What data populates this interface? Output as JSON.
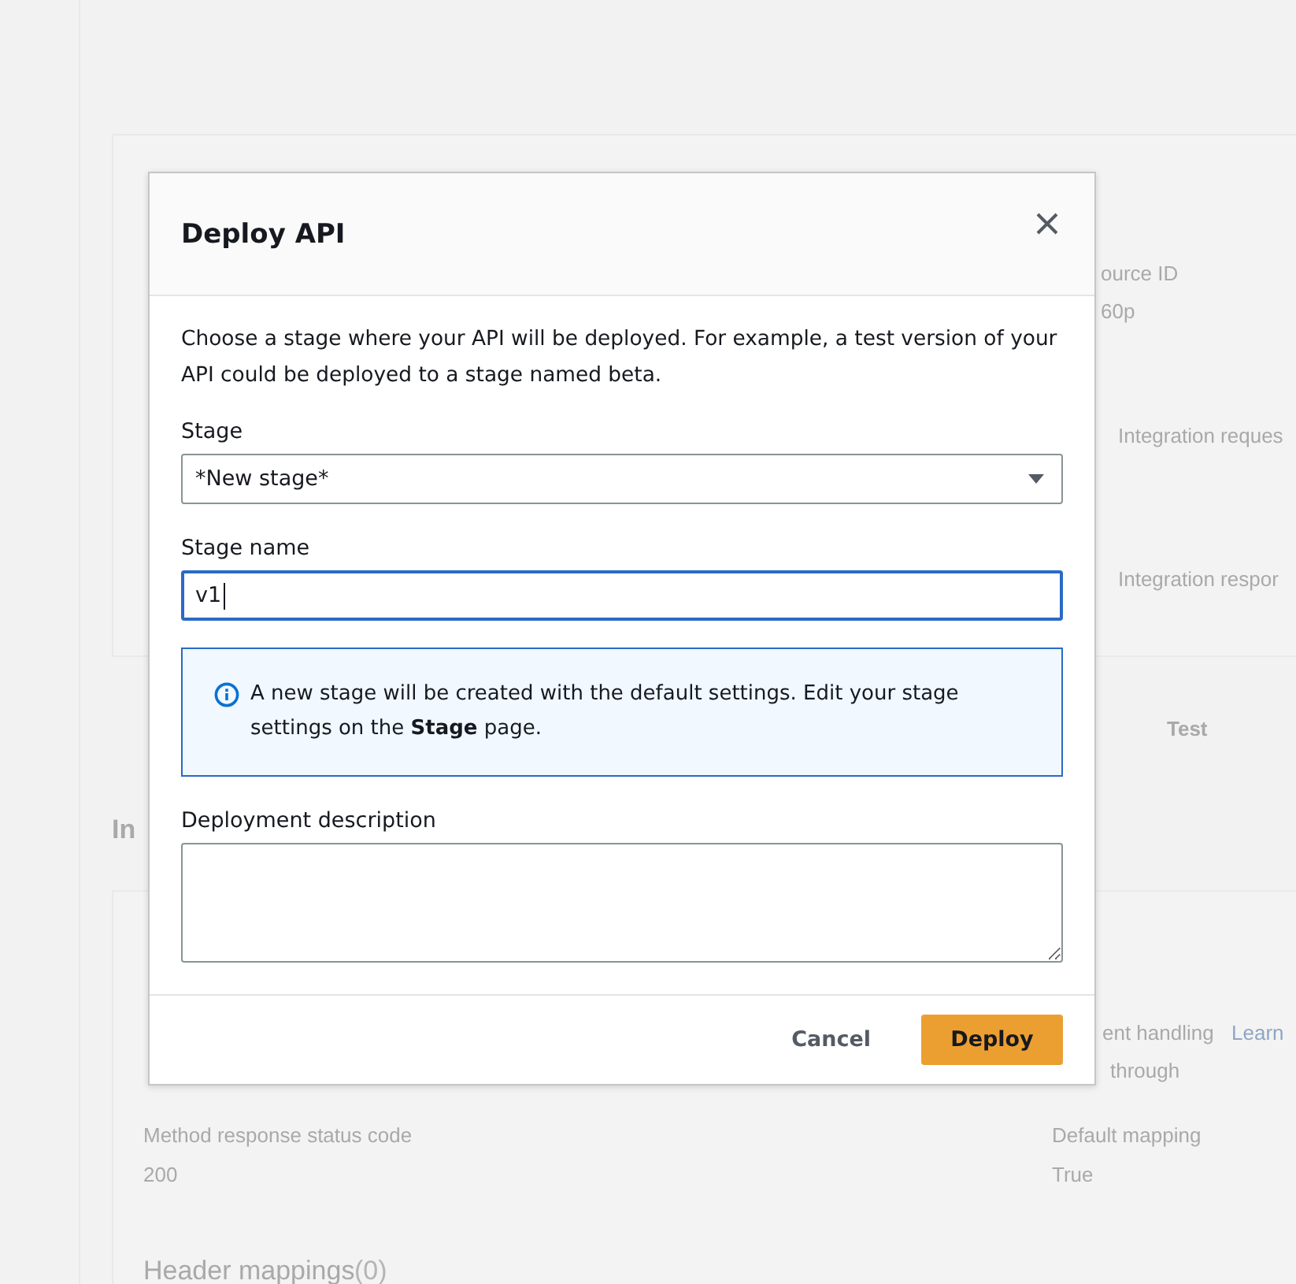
{
  "background": {
    "texts": [
      {
        "text": "ource ID"
      },
      {
        "text": "60p"
      },
      {
        "text": "Integration reques"
      },
      {
        "text": "Integration respor"
      },
      {
        "text": "Test"
      },
      {
        "text": "In"
      },
      {
        "text": "ent handling"
      },
      {
        "text": "Learn",
        "kind": "link"
      },
      {
        "text": "through"
      },
      {
        "text": "Method response status code"
      },
      {
        "text": "200"
      },
      {
        "text": "Default mapping"
      },
      {
        "text": "True"
      },
      {
        "text": "Header mappings"
      },
      {
        "text": "(0)"
      }
    ]
  },
  "dialog": {
    "title": "Deploy API",
    "description": "Choose a stage where your API will be deployed. For example, a test version of your API could be deployed to a stage named beta.",
    "fields": [
      {
        "kind": "select",
        "label": "Stage",
        "value": "*New stage*",
        "focused": false
      },
      {
        "kind": "text",
        "label": "Stage name",
        "value": "v1",
        "focused": true
      },
      {
        "kind": "info",
        "text": "A new stage will be created with the default settings. Edit your stage settings on the **Stage** page."
      },
      {
        "kind": "textarea",
        "label": "Deployment description",
        "focused": false
      }
    ],
    "buttons": [
      {
        "label": "Cancel",
        "kind": "link"
      },
      {
        "label": "Deploy",
        "kind": "primary"
      }
    ]
  }
}
